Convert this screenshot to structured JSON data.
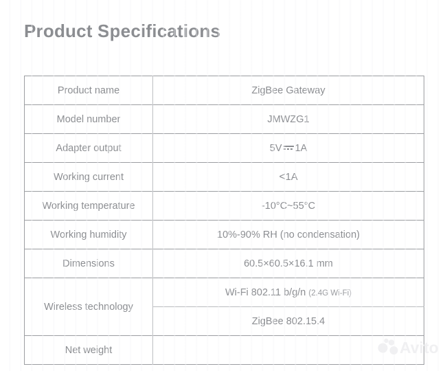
{
  "page": {
    "title": "Product Specifications",
    "text_color": "#8b8d91",
    "border_color": "#9b9da1",
    "background": "#ffffff"
  },
  "spec_table": {
    "rows": [
      {
        "label": "Product name",
        "value": "ZigBee Gateway"
      },
      {
        "label": "Model number",
        "value": "JMWZG1"
      },
      {
        "label": "Adapter output",
        "value_prefix": "5V",
        "value_suffix": "1A",
        "symbol": "dc-current-icon"
      },
      {
        "label": "Working current",
        "value_prefix": "<",
        "value_suffix": "1A"
      },
      {
        "label": "Working temperature",
        "value": "-10°C~55°C"
      },
      {
        "label": "Working humidity",
        "value": "10%-90% RH (no condensation)"
      },
      {
        "label": "Dimensions",
        "value": "60.5×60.5×16.1 mm"
      },
      {
        "label": "Wireless technology",
        "sub_values": [
          {
            "main": "Wi-Fi 802.11 b/g/n",
            "note": "(2.4G Wi-Fi)"
          },
          {
            "main": "ZigBee 802.15.4",
            "note": ""
          }
        ]
      },
      {
        "label": "Net weight",
        "value": ""
      }
    ]
  },
  "watermark": {
    "brand": "Avito",
    "color": "#f2f2f4"
  }
}
